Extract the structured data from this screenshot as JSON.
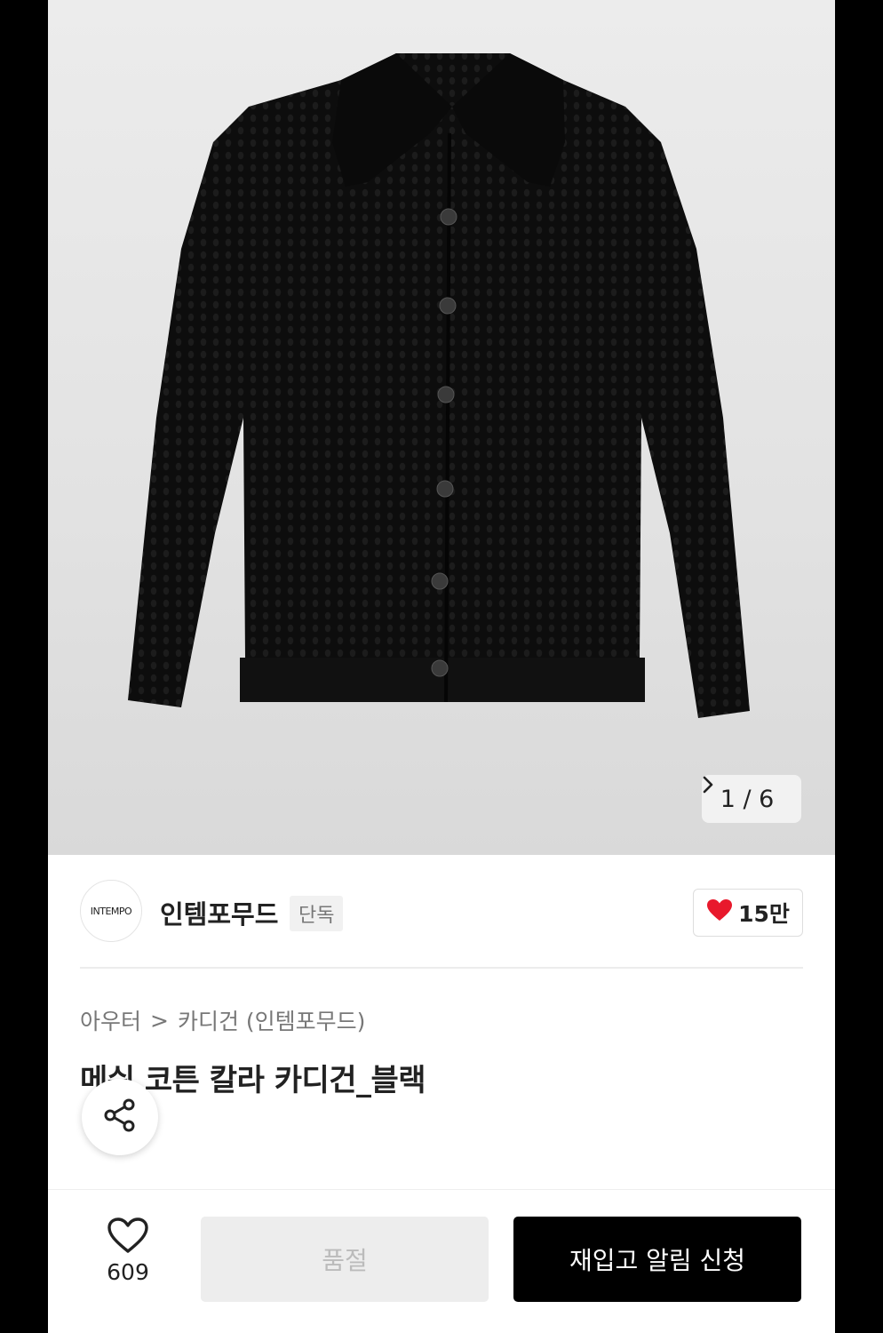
{
  "gallery": {
    "product_image": "black-knit-cardigan",
    "counter_text": "1 / 6",
    "next_icon": "chevron-right-icon"
  },
  "brand": {
    "logo_text": "INTEMPO",
    "name": "인템포무드",
    "badge": "단독",
    "likes": "15만",
    "like_icon": "heart-filled-icon",
    "like_color": "#e8192c"
  },
  "breadcrumb": {
    "category": "아우터",
    "separator": ">",
    "subcategory": "카디건 (인템포무드)"
  },
  "product": {
    "title": "메쉬 코튼 칼라 카디건_블랙"
  },
  "share": {
    "icon": "share-icon"
  },
  "bottom_bar": {
    "wish_icon": "heart-outline-icon",
    "wish_count": "609",
    "soldout_label": "품절",
    "restock_label": "재입고 알림 신청"
  }
}
